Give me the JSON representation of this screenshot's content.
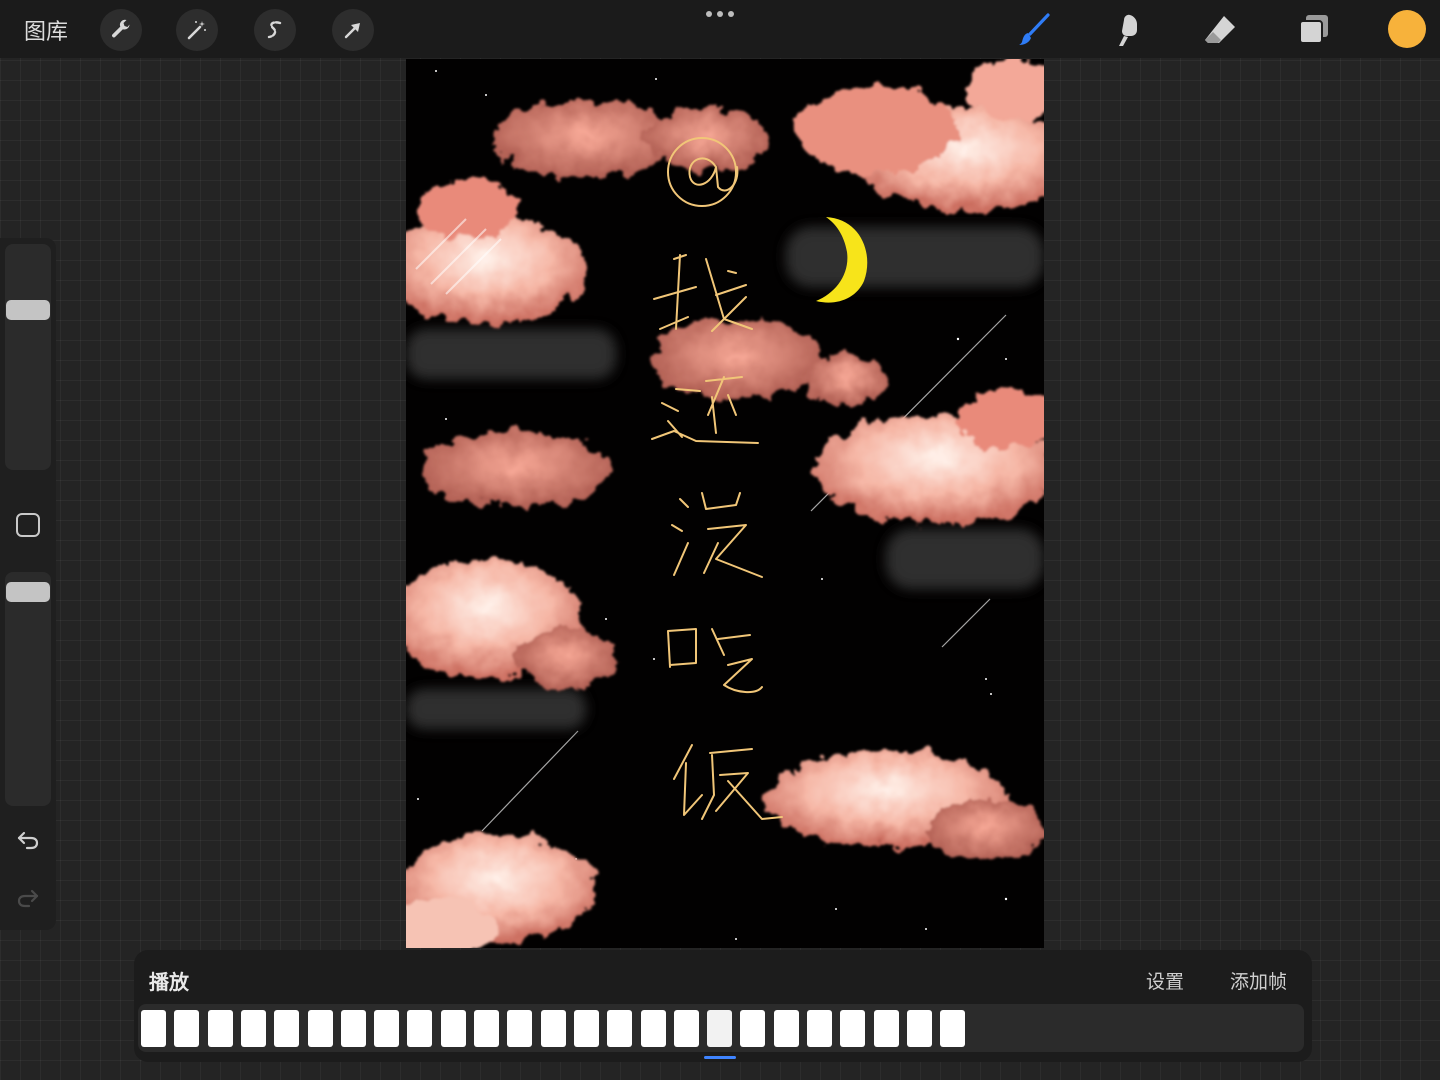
{
  "topbar": {
    "gallery_label": "图库",
    "left_tools": [
      "wrench-icon",
      "magic-wand-icon",
      "selection-icon",
      "transform-arrow-icon"
    ],
    "more_menu": "more-dots-icon",
    "right_tools": [
      "brush-icon",
      "smudge-icon",
      "eraser-icon",
      "layers-icon"
    ],
    "current_color": "#f7b23b",
    "brush_active_color": "#2f7cf6"
  },
  "sidebar": {
    "brush_size_level": 0.7,
    "opacity_level": 1.0,
    "modify_button": "square-icon",
    "undo": "undo-icon",
    "redo": "redo-icon"
  },
  "canvas": {
    "background": "#020101",
    "handwriting": [
      "@",
      "我",
      "还",
      "没",
      "吃",
      "饭"
    ],
    "text_color": "#f1c678",
    "moon_color": "#f7e41a",
    "cloud_color": "#ee8f7f"
  },
  "animation": {
    "title": "播放",
    "settings_label": "设置",
    "add_frame_label": "添加帧",
    "frame_count": 25,
    "selected_frame": 18
  }
}
